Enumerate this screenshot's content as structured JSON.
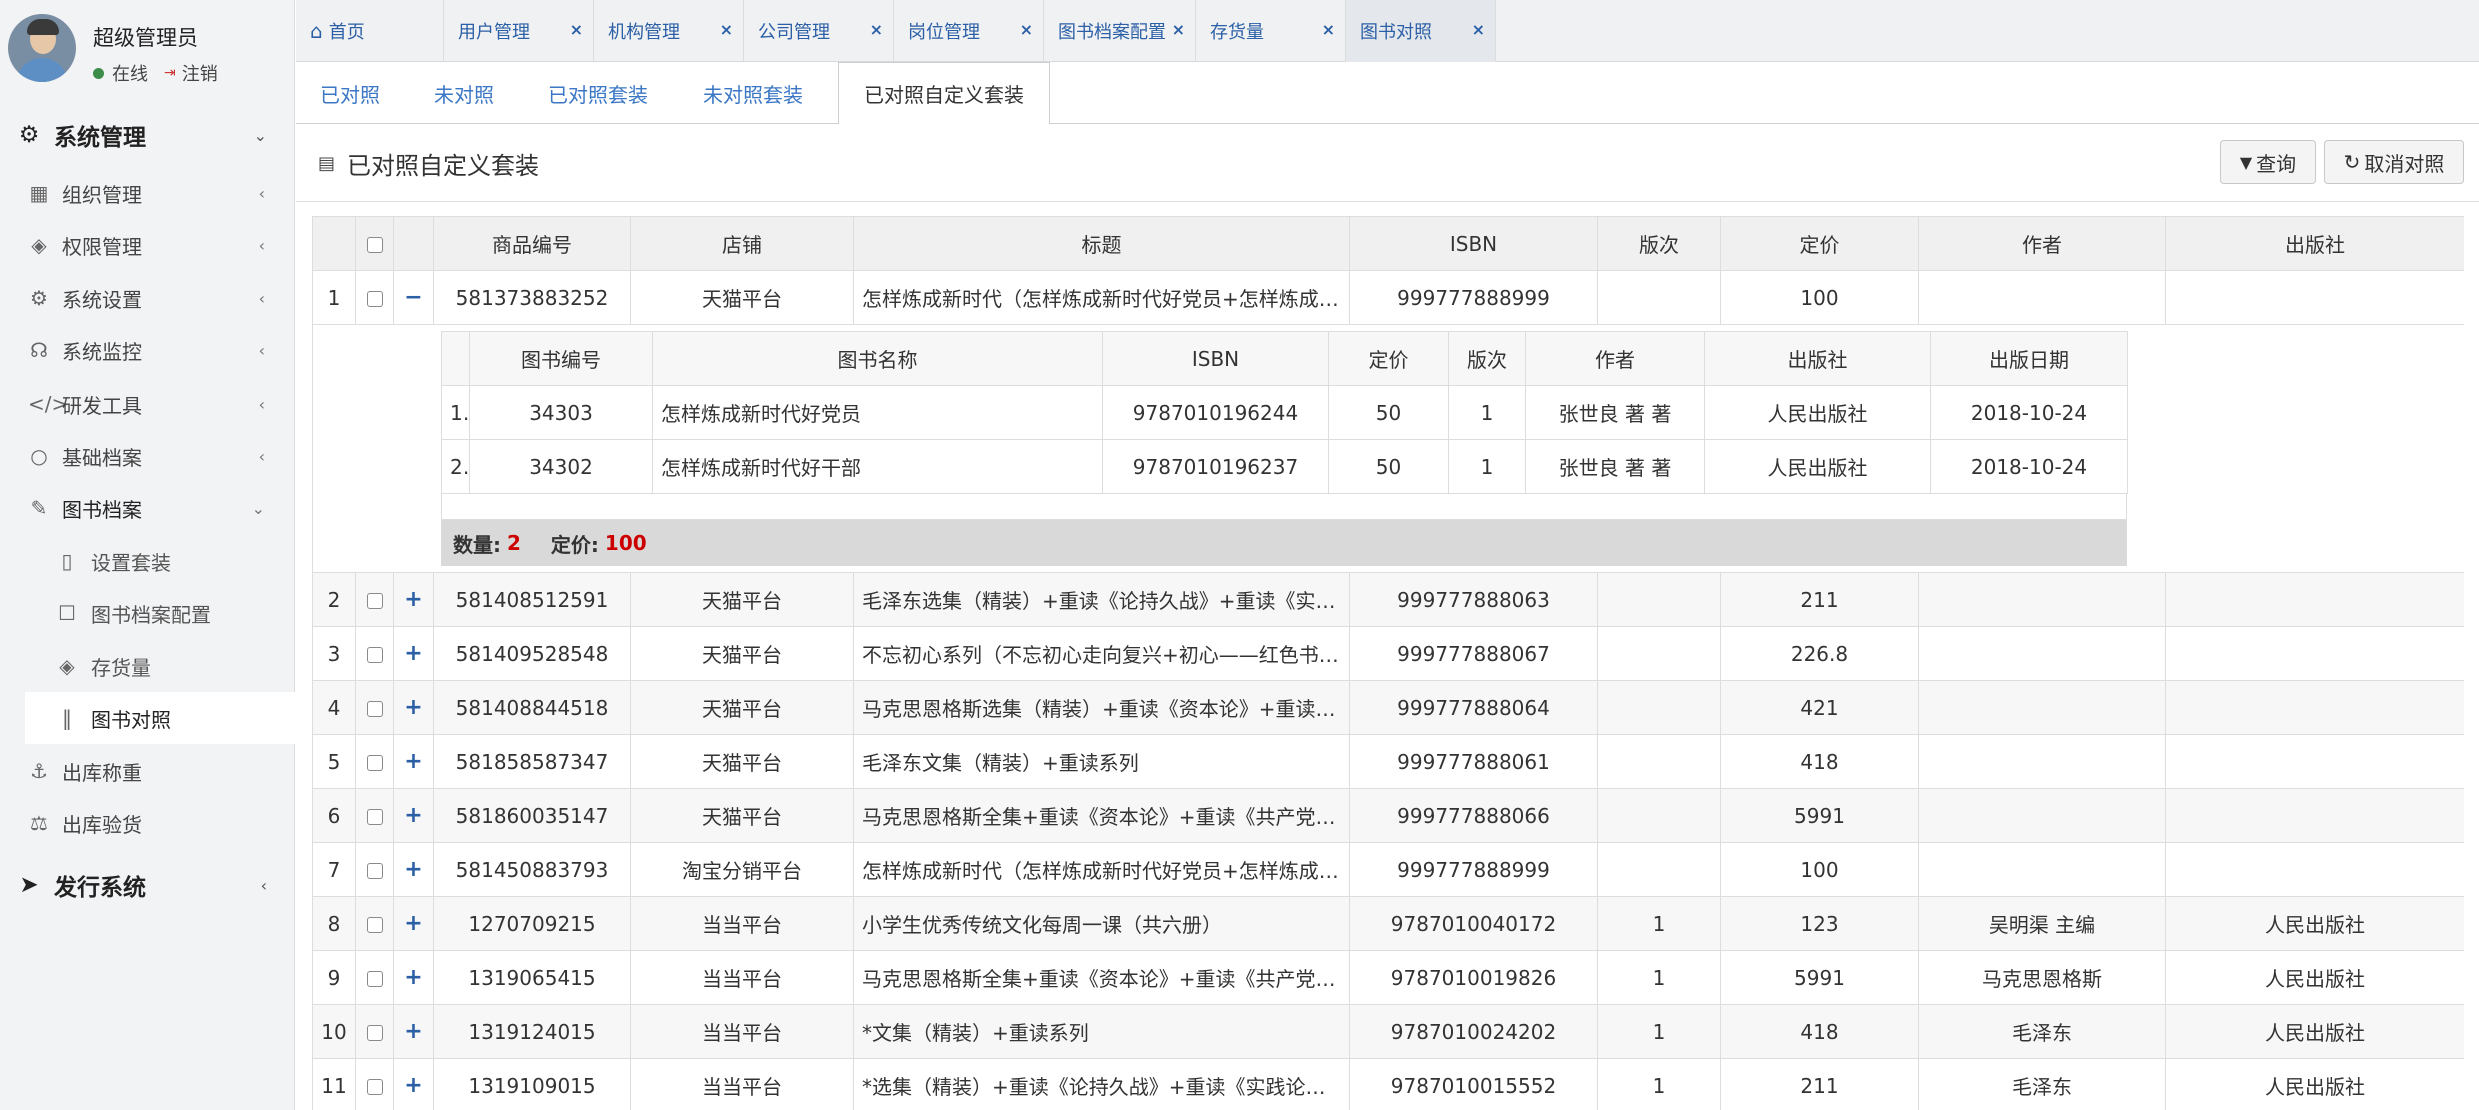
{
  "user": {
    "name": "超级管理员",
    "status": "在线",
    "logout": "注销"
  },
  "sidebar": {
    "system": "系统管理",
    "items": [
      {
        "label": "组织管理",
        "icon": "grid-icon"
      },
      {
        "label": "权限管理",
        "icon": "layers-icon"
      },
      {
        "label": "系统设置",
        "icon": "gear-icon"
      },
      {
        "label": "系统监控",
        "icon": "monitor-icon"
      },
      {
        "label": "研发工具",
        "icon": "code-icon"
      },
      {
        "label": "基础档案",
        "icon": "circle-icon"
      },
      {
        "label": "图书档案",
        "icon": "edit-icon"
      }
    ],
    "sub": [
      {
        "label": "设置套装",
        "icon": "book-icon"
      },
      {
        "label": "图书档案配置",
        "icon": "calendar-icon"
      },
      {
        "label": "存货量",
        "icon": "stack-icon"
      },
      {
        "label": "图书对照",
        "icon": "columns-icon"
      }
    ],
    "items2": [
      {
        "label": "出库称重",
        "icon": "anchor-icon"
      },
      {
        "label": "出库验货",
        "icon": "scale-icon"
      }
    ],
    "issue": "发行系统"
  },
  "tabs": [
    {
      "label": "首页"
    },
    {
      "label": "用户管理"
    },
    {
      "label": "机构管理"
    },
    {
      "label": "公司管理"
    },
    {
      "label": "岗位管理"
    },
    {
      "label": "图书档案配置"
    },
    {
      "label": "存货量"
    },
    {
      "label": "图书对照"
    }
  ],
  "subtabs": [
    {
      "label": "已对照"
    },
    {
      "label": "未对照"
    },
    {
      "label": "已对照套装"
    },
    {
      "label": "未对照套装"
    },
    {
      "label": "已对照自定义套装"
    }
  ],
  "panel": {
    "title": "已对照自定义套装",
    "query": "查询",
    "cancel": "取消对照"
  },
  "table": {
    "headers": [
      "商品编号",
      "店铺",
      "标题",
      "ISBN",
      "版次",
      "定价",
      "作者",
      "出版社"
    ],
    "rows": [
      {
        "no": "1",
        "toggle": "−",
        "code": "581373883252",
        "shop": "天猫平台",
        "title": "怎样炼成新时代（怎样炼成新时代好党员+怎样炼成新时代好干部）",
        "isbn": "999777888999",
        "ed": "",
        "price": "100",
        "author": "",
        "pub": ""
      },
      {
        "no": "2",
        "toggle": "+",
        "code": "581408512591",
        "shop": "天猫平台",
        "title": "毛泽东选集（精装）+重读《论持久战》+重读《实践论》",
        "isbn": "999777888063",
        "ed": "",
        "price": "211",
        "author": "",
        "pub": ""
      },
      {
        "no": "3",
        "toggle": "+",
        "code": "581409528548",
        "shop": "天猫平台",
        "title": "不忘初心系列（不忘初心走向复兴+初心——红色书系）",
        "isbn": "999777888067",
        "ed": "",
        "price": "226.8",
        "author": "",
        "pub": ""
      },
      {
        "no": "4",
        "toggle": "+",
        "code": "581408844518",
        "shop": "天猫平台",
        "title": "马克思恩格斯选集（精装）+重读《资本论》+重读《共产党宣言》",
        "isbn": "999777888064",
        "ed": "",
        "price": "421",
        "author": "",
        "pub": ""
      },
      {
        "no": "5",
        "toggle": "+",
        "code": "581858587347",
        "shop": "天猫平台",
        "title": "毛泽东文集（精装）+重读系列",
        "isbn": "999777888061",
        "ed": "",
        "price": "418",
        "author": "",
        "pub": ""
      },
      {
        "no": "6",
        "toggle": "+",
        "code": "581860035147",
        "shop": "天猫平台",
        "title": "马克思恩格斯全集+重读《资本论》+重读《共产党宣言》",
        "isbn": "999777888066",
        "ed": "",
        "price": "5991",
        "author": "",
        "pub": ""
      },
      {
        "no": "7",
        "toggle": "+",
        "code": "581450883793",
        "shop": "淘宝分销平台",
        "title": "怎样炼成新时代（怎样炼成新时代好党员+怎样炼成新时代好干部）",
        "isbn": "999777888999",
        "ed": "",
        "price": "100",
        "author": "",
        "pub": ""
      },
      {
        "no": "8",
        "toggle": "+",
        "code": "1270709215",
        "shop": "当当平台",
        "title": "小学生优秀传统文化每周一课（共六册）",
        "isbn": "9787010040172",
        "ed": "1",
        "price": "123",
        "author": "吴明渠 主编",
        "pub": "人民出版社"
      },
      {
        "no": "9",
        "toggle": "+",
        "code": "1319065415",
        "shop": "当当平台",
        "title": "马克思恩格斯全集+重读《资本论》+重读《共产党宣言》",
        "isbn": "9787010019826",
        "ed": "1",
        "price": "5991",
        "author": "马克思恩格斯",
        "pub": "人民出版社"
      },
      {
        "no": "10",
        "toggle": "+",
        "code": "1319124015",
        "shop": "当当平台",
        "title": "*文集（精装）+重读系列",
        "isbn": "9787010024202",
        "ed": "1",
        "price": "418",
        "author": "毛泽东",
        "pub": "人民出版社"
      },
      {
        "no": "11",
        "toggle": "+",
        "code": "1319109015",
        "shop": "当当平台",
        "title": "*选集（精装）+重读《论持久战》+重读《实践论》+重读《矛盾论》",
        "isbn": "9787010015552",
        "ed": "1",
        "price": "211",
        "author": "毛泽东",
        "pub": "人民出版社"
      }
    ]
  },
  "detail": {
    "headers": [
      "图书编号",
      "图书名称",
      "ISBN",
      "定价",
      "版次",
      "作者",
      "出版社",
      "出版日期"
    ],
    "rows": [
      {
        "no": "1",
        "code": "34303",
        "name": "怎样炼成新时代好党员",
        "isbn": "9787010196244",
        "price": "50",
        "ed": "1",
        "author": "张世良 著 著",
        "pub": "人民出版社",
        "date": "2018-10-24"
      },
      {
        "no": "2",
        "code": "34302",
        "name": "怎样炼成新时代好干部",
        "isbn": "9787010196237",
        "price": "50",
        "ed": "1",
        "author": "张世良 著 著",
        "pub": "人民出版社",
        "date": "2018-10-24"
      }
    ],
    "summary": {
      "qty_label": "数量:",
      "qty": "2",
      "price_label": "定价:",
      "price": "100"
    }
  }
}
